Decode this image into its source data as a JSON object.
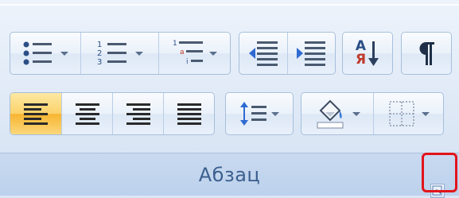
{
  "ribbon": {
    "group_label": "Абзац"
  },
  "icons": {
    "bullets": "bullet-list-icon",
    "numbering": "numbered-list-icon",
    "multilevel": "multilevel-list-icon",
    "decrease_indent": "decrease-indent-icon",
    "increase_indent": "increase-indent-icon",
    "sort": "sort-icon",
    "show_marks": "pilcrow-icon",
    "align_left": "align-left-icon",
    "center": "align-center-icon",
    "align_right": "align-right-icon",
    "justify": "justify-icon",
    "line_spacing": "line-spacing-icon",
    "shading": "shading-icon",
    "borders": "borders-icon",
    "launcher": "dialog-launcher-icon"
  },
  "sort_letters": {
    "top": "А",
    "bottom": "Я"
  },
  "colors": {
    "active": "#f7b531",
    "highlight_box": "#e2141b",
    "label_text": "#3b5f8e"
  }
}
